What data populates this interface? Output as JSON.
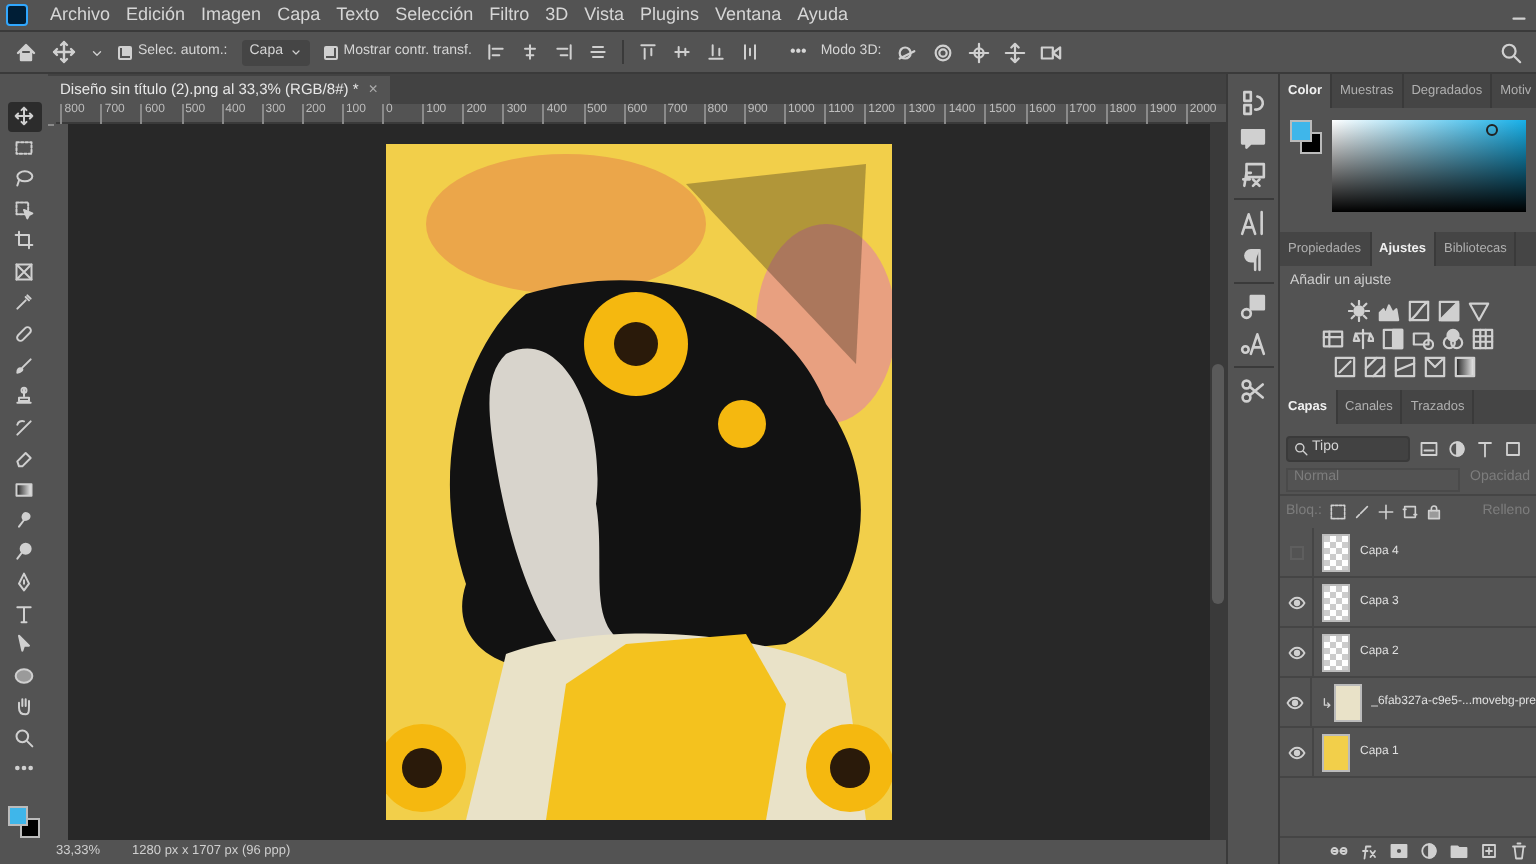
{
  "menu": [
    "Archivo",
    "Edición",
    "Imagen",
    "Capa",
    "Texto",
    "Selección",
    "Filtro",
    "3D",
    "Vista",
    "Plugins",
    "Ventana",
    "Ayuda"
  ],
  "options": {
    "auto_select": {
      "label": "Selec. autom.:",
      "checked": true
    },
    "target": "Capa",
    "show_transform": {
      "label": "Mostrar contr. transf.",
      "checked": true
    },
    "more": "•••",
    "mode_3d": "Modo 3D:"
  },
  "tools": [
    {
      "selected": true
    },
    {
      "selected": false
    },
    {
      "selected": false
    },
    {
      "selected": false
    },
    {
      "selected": false
    },
    {
      "selected": false
    },
    {
      "selected": false
    },
    {
      "selected": false
    },
    {
      "selected": false
    },
    {
      "selected": false
    },
    {
      "selected": false
    },
    {
      "selected": false
    },
    {
      "selected": false
    },
    {
      "selected": false
    },
    {
      "selected": false
    },
    {
      "selected": false
    },
    {
      "selected": false
    },
    {
      "selected": false
    },
    {
      "selected": false
    },
    {
      "selected": false
    },
    {
      "selected": false
    },
    {
      "selected": false
    }
  ],
  "document_tab": {
    "title": "Diseño sin título (2).png al 33,3% (RGB/8#) *",
    "close": "×"
  },
  "ruler": [
    "800",
    "700",
    "600",
    "500",
    "400",
    "300",
    "200",
    "100",
    "0",
    "100",
    "200",
    "300",
    "400",
    "500",
    "600",
    "700",
    "800",
    "900",
    "1000",
    "1100",
    "1200",
    "1300",
    "1400",
    "1500",
    "1600",
    "1700",
    "1800",
    "1900",
    "2000"
  ],
  "status_bar": {
    "zoom": "33,33%",
    "info": "1280 px x 1707 px (96 ppp)"
  },
  "color_panel": {
    "tabs": [
      {
        "label": "Color",
        "selected": true
      },
      {
        "label": "Muestras",
        "selected": false
      },
      {
        "label": "Degradados",
        "selected": false
      },
      {
        "label": "Motiv",
        "selected": false
      }
    ]
  },
  "adjustments_panel": {
    "tabs": [
      {
        "label": "Propiedades",
        "selected": false
      },
      {
        "label": "Ajustes",
        "selected": true
      },
      {
        "label": "Bibliotecas",
        "selected": false
      }
    ],
    "heading": "Añadir un ajuste"
  },
  "layers_panel": {
    "tabs": [
      {
        "label": "Capas",
        "selected": true
      },
      {
        "label": "Canales",
        "selected": false
      },
      {
        "label": "Trazados",
        "selected": false
      }
    ],
    "filter": "Tipo",
    "blend_mode": "Normal",
    "opacity_label": "Opacidad",
    "lock_label": "Bloq.:",
    "fill_label": "Relleno",
    "layers": [
      {
        "name": "Capa 4",
        "visible": false,
        "clipped": false
      },
      {
        "name": "Capa 3",
        "visible": true,
        "clipped": false
      },
      {
        "name": "Capa 2",
        "visible": true,
        "clipped": false
      },
      {
        "name": "_6fab327a-c9e5-...movebg-pre",
        "visible": true,
        "clipped": true
      },
      {
        "name": "Capa 1",
        "visible": true,
        "clipped": false
      }
    ]
  }
}
